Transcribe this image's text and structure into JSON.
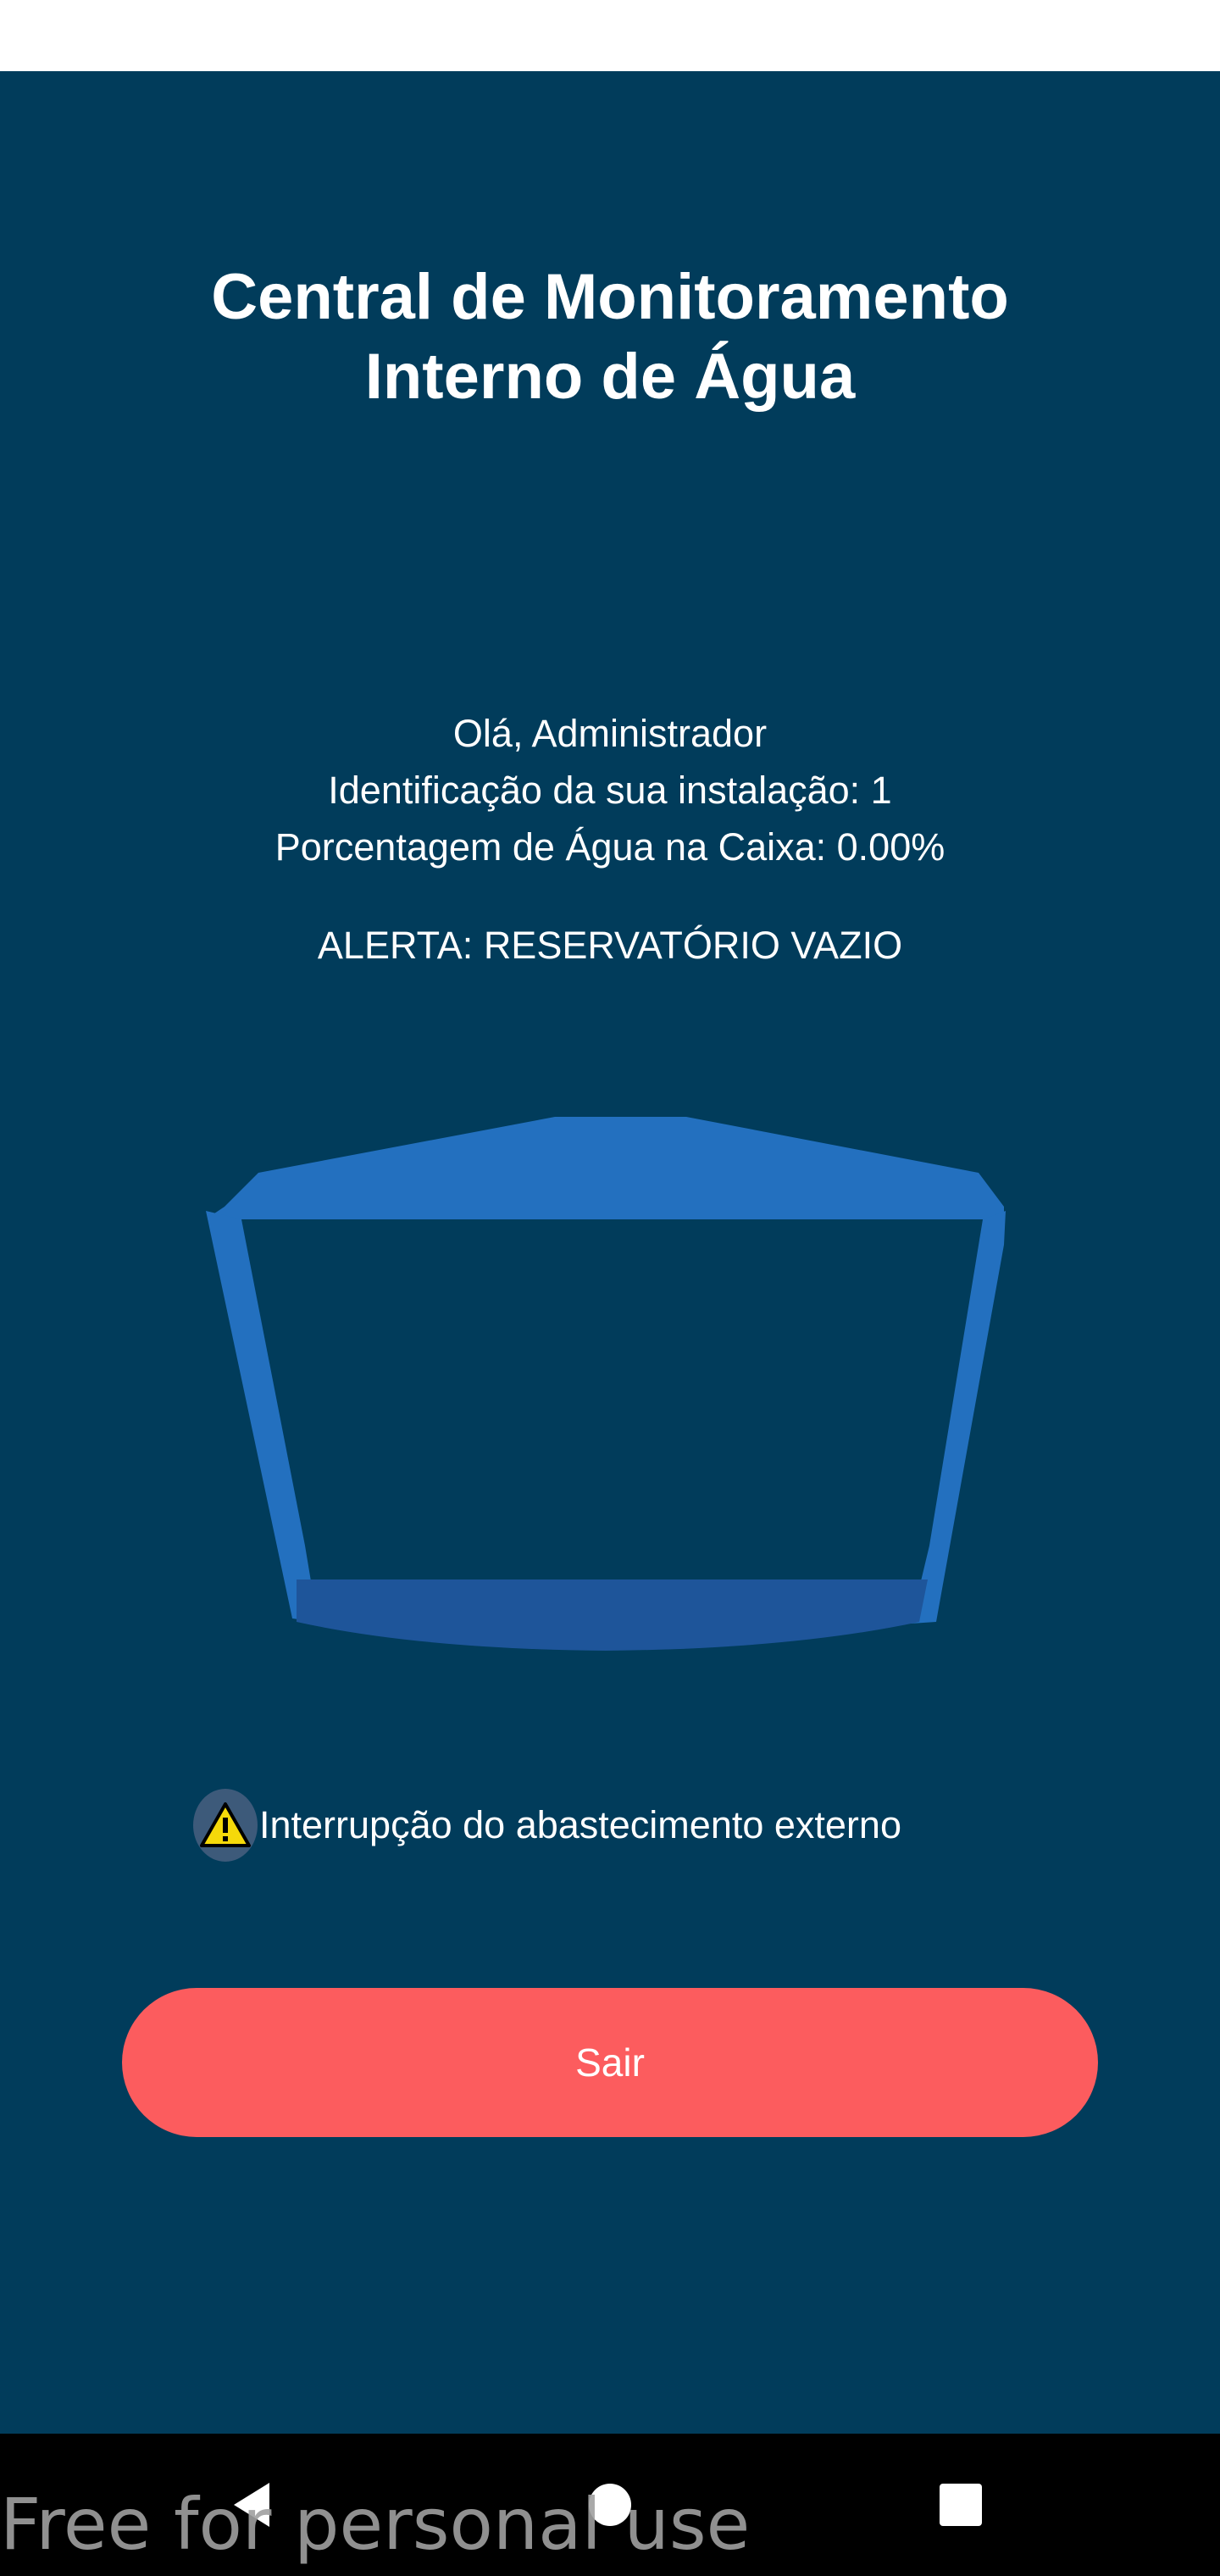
{
  "header": {
    "title_line1": "Central de Monitoramento",
    "title_line2": "Interno de Água"
  },
  "info": {
    "greeting": "Olá, Administrador",
    "installation": "Identificação da sua instalação: 1",
    "water_percentage": "Porcentagem de Água na Caixa: 0.00%",
    "water_level_fraction": 0.0
  },
  "alert": {
    "message": "ALERTA: RESERVATÓRIO VAZIO"
  },
  "notice": {
    "icon": "warning-icon",
    "text": "Interrupção do abastecimento externo"
  },
  "actions": {
    "logout_label": "Sair"
  },
  "navigation": {
    "back_icon": "back-triangle-icon",
    "home_icon": "home-circle-icon",
    "recents_icon": "recents-square-icon"
  },
  "watermark": {
    "text": "Free for personal use"
  },
  "colors": {
    "background": "#013c5b",
    "tank": "#2370bf",
    "logout_button": "#fc5c5e",
    "warning": "#f5d90a"
  }
}
